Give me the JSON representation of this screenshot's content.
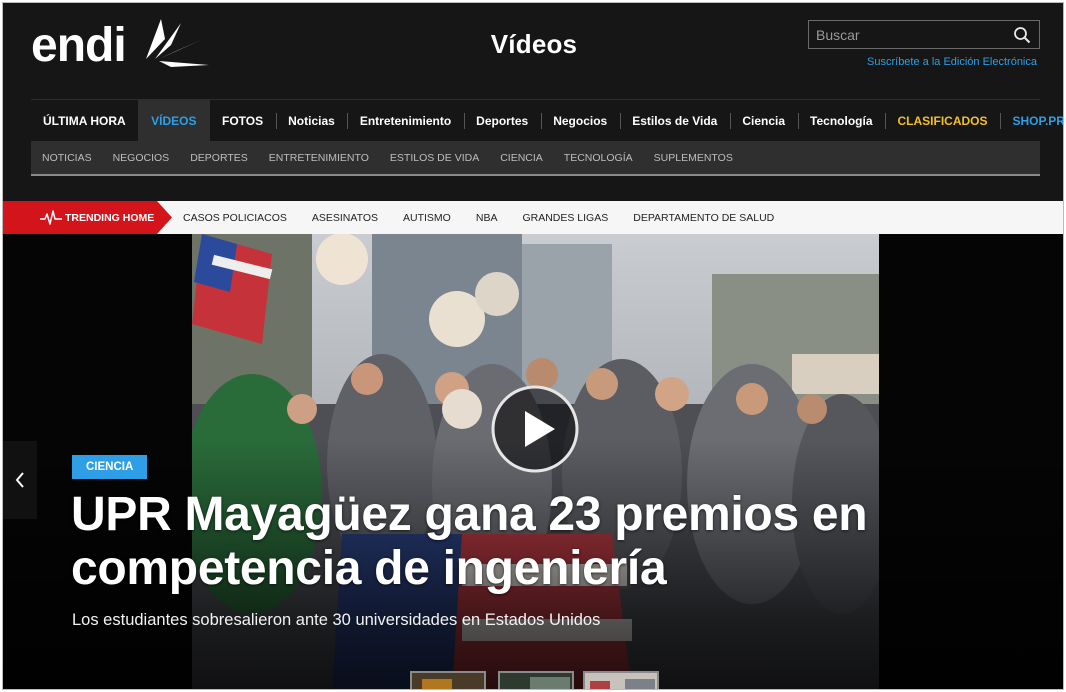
{
  "brand": {
    "logo_text": "endi",
    "accent": "#2e9fe6",
    "highlight": "#f2c024",
    "trending_red": "#d3141b"
  },
  "header": {
    "title": "Vídeos",
    "search_placeholder": "Buscar",
    "subscribe_link": "Suscríbete a la Edición Electrónica"
  },
  "main_nav": [
    {
      "label": "ÚLTIMA HORA"
    },
    {
      "label": "VÍDEOS",
      "active": true
    },
    {
      "label": "FOTOS"
    },
    {
      "label": "Noticias"
    },
    {
      "label": "Entretenimiento"
    },
    {
      "label": "Deportes"
    },
    {
      "label": "Negocios"
    },
    {
      "label": "Estilos de Vida"
    },
    {
      "label": "Ciencia"
    },
    {
      "label": "Tecnología"
    },
    {
      "label": "CLASIFICADOS"
    },
    {
      "label": "SHOP.PR"
    }
  ],
  "sub_nav": [
    "NOTICIAS",
    "NEGOCIOS",
    "DEPORTES",
    "ENTRETENIMIENTO",
    "ESTILOS DE VIDA",
    "CIENCIA",
    "TECNOLOGÍA",
    "SUPLEMENTOS"
  ],
  "trending": {
    "tag": "TRENDING HOME",
    "links": [
      "CASOS POLICIACOS",
      "ASESINATOS",
      "AUTISMO",
      "NBA",
      "GRANDES LIGAS",
      "DEPARTAMENTO DE SALUD"
    ]
  },
  "hero": {
    "category": "CIENCIA",
    "headline": "UPR Mayagüez gana 23 premios en competencia de ingeniería",
    "subheadline": "Los estudiantes sobresalieron ante 30 universidades en Estados Unidos"
  },
  "icons": {
    "search": "magnifier",
    "play": "play-circle",
    "prev": "chevron-left",
    "pulse": "heartbeat-line"
  }
}
